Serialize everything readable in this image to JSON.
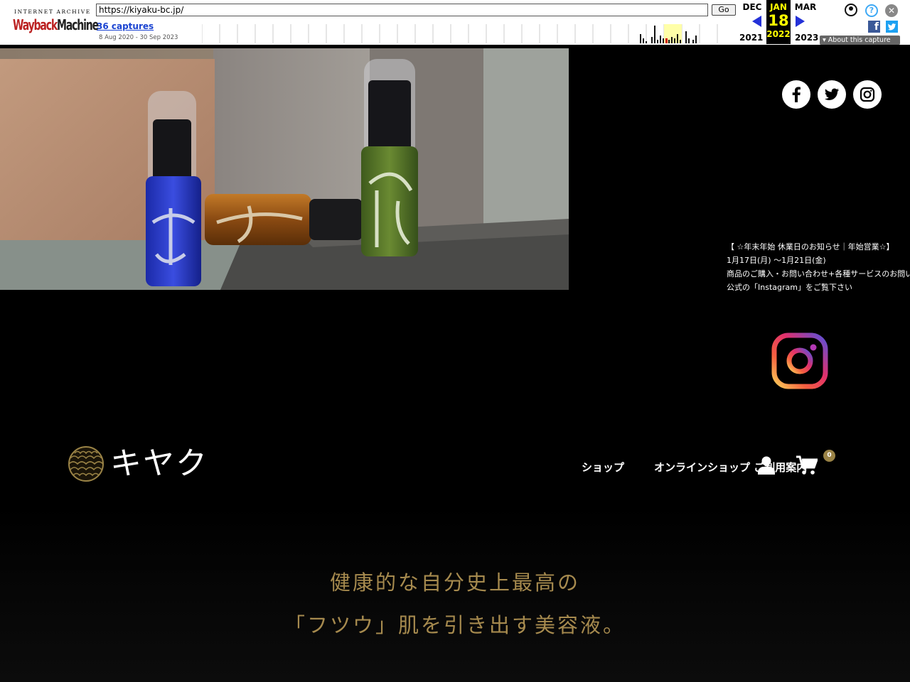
{
  "wayback": {
    "logo_top": "INTERNET ARCHIVE",
    "logo_wayback": "Wayback",
    "logo_machine": "Machine",
    "url": "https://kiyaku-bc.jp/",
    "go_label": "Go",
    "captures": "36 captures",
    "range": "8 Aug 2020 - 30 Sep 2023",
    "prev_month": "DEC",
    "cur_month": "JAN",
    "next_month": "MAR",
    "cur_day": "18",
    "prev_year": "2021",
    "cur_year": "2022",
    "next_year": "2023",
    "about": "About this capture",
    "help_glyph": "?",
    "close_glyph": "✕",
    "fb_glyph": "f"
  },
  "notice": {
    "line1": "【 ☆年末年始 休業日のお知らせ｜年始営業☆】",
    "line2": "1月17日(月) 〜1月21日(金)",
    "line3": "商品のご購入・お問い合わせ+各種サービスのお問い合わせ",
    "line4": "公式の「Instagram」をご覧下さい"
  },
  "site": {
    "logo_text": "キヤク",
    "nav": {
      "item1": "ショップ",
      "item2": "オンラインショップ ご利用案内"
    },
    "cart_count": "0",
    "tagline1": "健康的な自分史上最高の",
    "tagline2": "「フツウ」肌を引き出す美容液。"
  },
  "icons": {
    "social": [
      "facebook-icon",
      "twitter-icon",
      "instagram-icon"
    ],
    "big": "instagram-logo-icon",
    "nav": [
      "user-icon",
      "cart-icon"
    ]
  },
  "colors": {
    "accent_gold": "#a68a4e",
    "badge": "#9a8346",
    "background": "#000000",
    "wayback_blue": "#2431d8",
    "wayback_yellow": "#ffff00"
  }
}
